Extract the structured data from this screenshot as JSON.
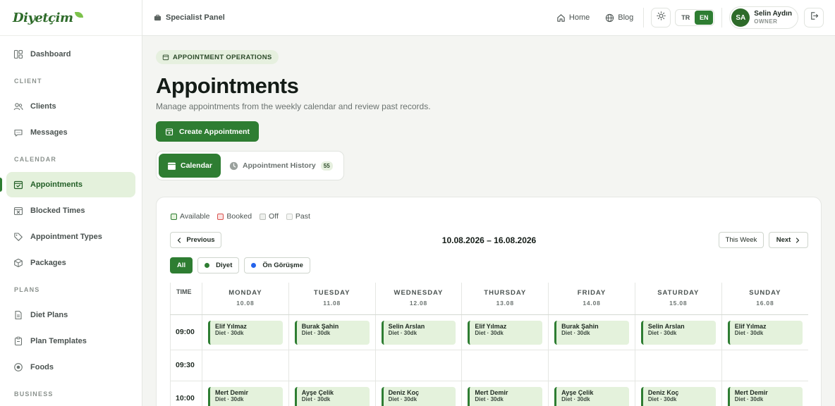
{
  "brand": {
    "logo_text": "Diyetçim",
    "accent": "#2e7d32"
  },
  "sidebar": {
    "items": [
      {
        "type": "item",
        "label": "Dashboard",
        "icon": "dashboard-icon"
      },
      {
        "type": "section",
        "label": "CLIENT"
      },
      {
        "type": "item",
        "label": "Clients",
        "icon": "users-icon"
      },
      {
        "type": "item",
        "label": "Messages",
        "icon": "chat-icon"
      },
      {
        "type": "section",
        "label": "CALENDAR"
      },
      {
        "type": "item",
        "label": "Appointments",
        "icon": "calendar-check-icon",
        "active": true
      },
      {
        "type": "item",
        "label": "Blocked Times",
        "icon": "calendar-x-icon"
      },
      {
        "type": "item",
        "label": "Appointment Types",
        "icon": "tag-icon"
      },
      {
        "type": "item",
        "label": "Packages",
        "icon": "package-icon"
      },
      {
        "type": "section",
        "label": "PLANS"
      },
      {
        "type": "item",
        "label": "Diet Plans",
        "icon": "document-icon"
      },
      {
        "type": "item",
        "label": "Plan Templates",
        "icon": "clipboard-icon"
      },
      {
        "type": "item",
        "label": "Foods",
        "icon": "food-icon"
      },
      {
        "type": "section",
        "label": "BUSINESS"
      }
    ]
  },
  "topbar": {
    "panel_label": "Specialist Panel",
    "home_label": "Home",
    "blog_label": "Blog",
    "lang_tr": "TR",
    "lang_en": "EN",
    "active_lang": "EN",
    "user_initials": "SA",
    "user_name": "Selin Aydın",
    "user_role": "OWNER"
  },
  "page": {
    "breadcrumb": "APPOINTMENT OPERATIONS",
    "title": "Appointments",
    "subtitle": "Manage appointments from the weekly calendar and review past records.",
    "create_label": "Create Appointment",
    "tab_calendar": "Calendar",
    "tab_history": "Appointment History",
    "history_count": "55"
  },
  "calendar": {
    "legend": [
      {
        "label": "Available",
        "border": "#2e7d32",
        "fill": "#e4f2dc"
      },
      {
        "label": "Booked",
        "border": "#d9534f",
        "fill": "#fbe3e2"
      },
      {
        "label": "Off",
        "border": "#b9bdb8",
        "fill": "#eef0ed"
      },
      {
        "label": "Past",
        "border": "#c9ccc7",
        "fill": "#f6f7f5"
      }
    ],
    "prev_label": "Previous",
    "range": "10.08.2026 – 16.08.2026",
    "this_week_label": "This Week",
    "next_label": "Next",
    "filters": [
      {
        "label": "All",
        "active": true
      },
      {
        "label": "Diyet",
        "dot": "#2e7d32"
      },
      {
        "label": "Ön Görüşme",
        "dot": "#2563eb"
      }
    ],
    "time_header": "TIME",
    "days": [
      {
        "name": "MONDAY",
        "date": "10.08"
      },
      {
        "name": "TUESDAY",
        "date": "11.08"
      },
      {
        "name": "WEDNESDAY",
        "date": "12.08"
      },
      {
        "name": "THURSDAY",
        "date": "13.08"
      },
      {
        "name": "FRIDAY",
        "date": "14.08"
      },
      {
        "name": "SATURDAY",
        "date": "15.08"
      },
      {
        "name": "SUNDAY",
        "date": "16.08"
      }
    ],
    "rows": [
      {
        "time": "09:00",
        "appts": [
          {
            "name": "Elif Yılmaz",
            "meta": "Diet · 30dk"
          },
          {
            "name": "Burak Şahin",
            "meta": "Diet · 30dk"
          },
          {
            "name": "Selin Arslan",
            "meta": "Diet · 30dk"
          },
          {
            "name": "Elif Yılmaz",
            "meta": "Diet · 30dk"
          },
          {
            "name": "Burak Şahin",
            "meta": "Diet · 30dk"
          },
          {
            "name": "Selin Arslan",
            "meta": "Diet · 30dk"
          },
          {
            "name": "Elif Yılmaz",
            "meta": "Diet · 30dk"
          }
        ]
      },
      {
        "time": "09:30",
        "appts": [
          null,
          null,
          null,
          null,
          null,
          null,
          null
        ]
      },
      {
        "time": "10:00",
        "appts": [
          {
            "name": "Mert Demir",
            "meta": "Diet · 30dk"
          },
          {
            "name": "Ayşe Çelik",
            "meta": "Diet · 30dk"
          },
          {
            "name": "Deniz Koç",
            "meta": "Diet · 30dk"
          },
          {
            "name": "Mert Demir",
            "meta": "Diet · 30dk"
          },
          {
            "name": "Ayşe Çelik",
            "meta": "Diet · 30dk"
          },
          {
            "name": "Deniz Koç",
            "meta": "Diet · 30dk"
          },
          {
            "name": "Mert Demir",
            "meta": "Diet · 30dk"
          }
        ]
      }
    ]
  }
}
